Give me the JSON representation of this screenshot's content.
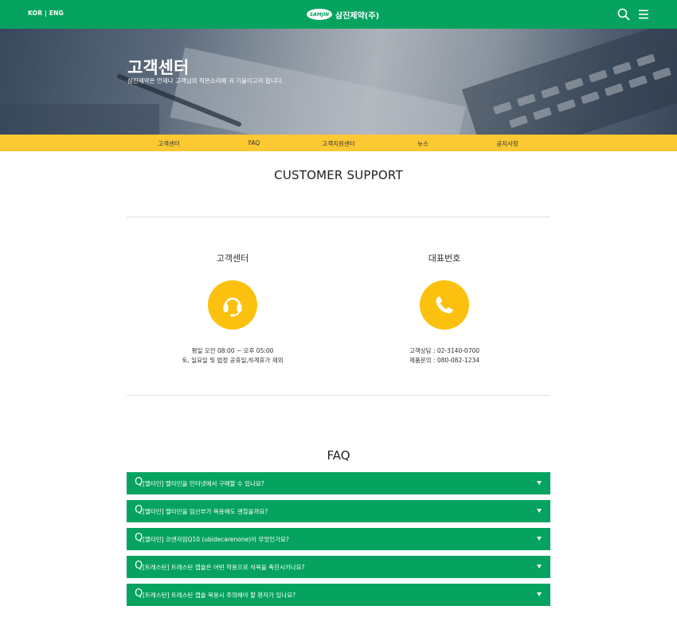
{
  "header": {
    "lang_kor": "KOR",
    "lang_sep": "|",
    "lang_eng": "ENG",
    "logo_badge": "SAMJIN",
    "logo_text": "삼진제약(주)",
    "search_icon": "search-icon",
    "menu_icon": "hamburger-menu-icon",
    "brand_color": "#05a35f"
  },
  "hero": {
    "title": "고객센터",
    "subtitle": "삼진제약은 언제나 고객님의 작은소리에 귀 기울이고자 합니다."
  },
  "subnav": {
    "items": [
      "고객센터",
      "FAQ",
      "고객지원센터",
      "뉴스",
      "공지사항"
    ],
    "color": "#fcc933"
  },
  "support": {
    "title": "CUSTOMER SUPPORT",
    "center": {
      "title": "고객센터",
      "icon": "headset-icon",
      "line1": "평일 오전 08:00 ~ 오후 05:00",
      "line2": "토, 일요일 및 법정 공휴일,하계휴가 제외"
    },
    "phone": {
      "title": "대표번호",
      "icon": "phone-icon",
      "line1": "고객상담 : 02-3140-0700",
      "line2": "제품문의 : 080-082-1234"
    },
    "icon_color": "#fcc10f"
  },
  "faq": {
    "title": "FAQ",
    "items": [
      {
        "q": "Q",
        "text": "[멜타민] 멜타민을 인터넷에서 구매할 수 있나요?"
      },
      {
        "q": "Q",
        "text": "[멜타민] 멜타민을 임산부가 복용해도 괜찮을까요?"
      },
      {
        "q": "Q",
        "text": "[멜타민] 코엔자임Q10 (ubidecarenone)이 무엇인가요?"
      },
      {
        "q": "Q",
        "text": "[트레스탄] 트레스탄 캡슐은 어떤 작용으로 식욕을 촉진시키나요?"
      },
      {
        "q": "Q",
        "text": "[트레스탄] 트레스탄 캡슐 복용시 주의해야 할 환자가 있나요?"
      }
    ]
  }
}
